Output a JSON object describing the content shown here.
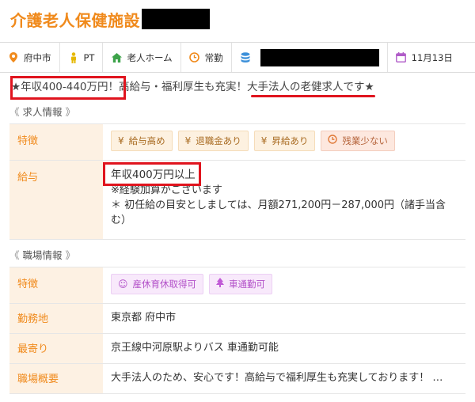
{
  "header": {
    "title": "介護老人保健施設"
  },
  "meta": {
    "location": "府中市",
    "job_type": "PT",
    "facility_type": "老人ホーム",
    "employment": "常勤",
    "date": "11月13日"
  },
  "catch_copy": {
    "highlight1": "★年収400-440万円！",
    "middle": "高給与・福利厚生も充実！",
    "highlight2": "大手法人の老健求人です",
    "tail": "★"
  },
  "job_section": {
    "heading": "求人情報",
    "bracket_open": "《",
    "bracket_close": "》",
    "features_label": "特徴",
    "features": [
      {
        "icon": "yen-icon",
        "label": "給与高め"
      },
      {
        "icon": "yen-icon",
        "label": "退職金あり"
      },
      {
        "icon": "yen-icon",
        "label": "昇給あり"
      },
      {
        "icon": "clock-icon",
        "label": "残業少ない"
      }
    ],
    "salary_label": "給与",
    "salary_main": "年収400万円以上",
    "salary_note1": "※経験加算がございます",
    "salary_note2": "＊ 初任給の目安としましては、月額271,200円－287,000円（諸手当含む）"
  },
  "workplace_section": {
    "heading": "職場情報",
    "bracket_open": "《",
    "bracket_close": "》",
    "features_label": "特徴",
    "features": [
      {
        "icon": "smiley-icon",
        "label": "産休育休取得可"
      },
      {
        "icon": "tree-icon",
        "label": "車通勤可"
      }
    ],
    "location_label": "勤務地",
    "location_value": "東京都 府中市",
    "access_label": "最寄り",
    "access_value": "京王線中河原駅よりバス 車通勤可能",
    "summary_label": "職場概要",
    "summary_value": "大手法人のため、安心です！高給与で福利厚生も充実しております！ …"
  },
  "colors": {
    "accent": "#f08a1c",
    "highlight_red": "#e0141e",
    "label_bg": "#fdf1e3"
  }
}
